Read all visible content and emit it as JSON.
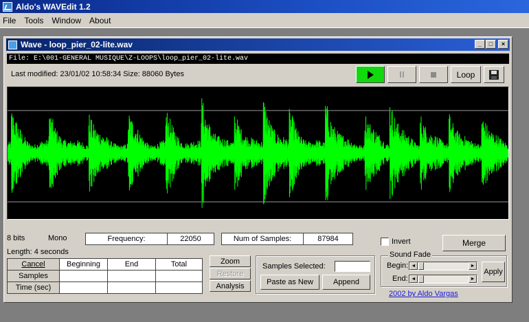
{
  "app": {
    "title": "Aldo's WAVEdit 1.2"
  },
  "menu": [
    {
      "label": "File"
    },
    {
      "label": "Tools"
    },
    {
      "label": "Window"
    },
    {
      "label": "About"
    }
  ],
  "wave_window": {
    "title": "Wave - loop_pier_02-lite.wav",
    "controls": {
      "minimize": "_",
      "maximize": "□",
      "close": "×"
    },
    "file_path": "File: E:\\001-GENERAL MUSIQUE\\Z-LOOPS\\loop_pier_02-lite.wav",
    "meta_text": "Last modified: 23/01/02 10:58:34   Size: 88060 Bytes",
    "transport": {
      "play_icon": "play-icon",
      "pause_icon": "pause-icon",
      "stop_icon": "stop-icon",
      "loop_label": "Loop",
      "save_icon": "floppy-disk-icon",
      "play_color": "#12d80e"
    },
    "waveform": {
      "background": "#000000",
      "wave_color": "#00ff00",
      "guide_color": "#9a9a9a"
    }
  },
  "info": {
    "bits": "8 bits",
    "channels": "Mono",
    "frequency_label": "Frequency:",
    "frequency_value": "22050",
    "num_samples_label": "Num of Samples:",
    "num_samples_value": "87984",
    "length": "Length: 4 seconds",
    "invert_label": "Invert",
    "merge_label": "Merge"
  },
  "selection_table": {
    "headers": [
      "Cancel",
      "Beginning",
      "End",
      "Total"
    ],
    "rows": [
      {
        "label": "Samples"
      },
      {
        "label": "Time (sec)"
      }
    ]
  },
  "zoom_buttons": {
    "zoom": "Zoom",
    "restore": "Restore",
    "analysis": "Analysis"
  },
  "samples_group": {
    "label": "Samples Selected:",
    "paste_label": "Paste as New",
    "append_label": "Append"
  },
  "fade_group": {
    "title": "Sound Fade",
    "begin_label": "Begin:",
    "end_label": "End:",
    "apply_label": "Apply"
  },
  "credit": "2002 by Aldo Vargas"
}
